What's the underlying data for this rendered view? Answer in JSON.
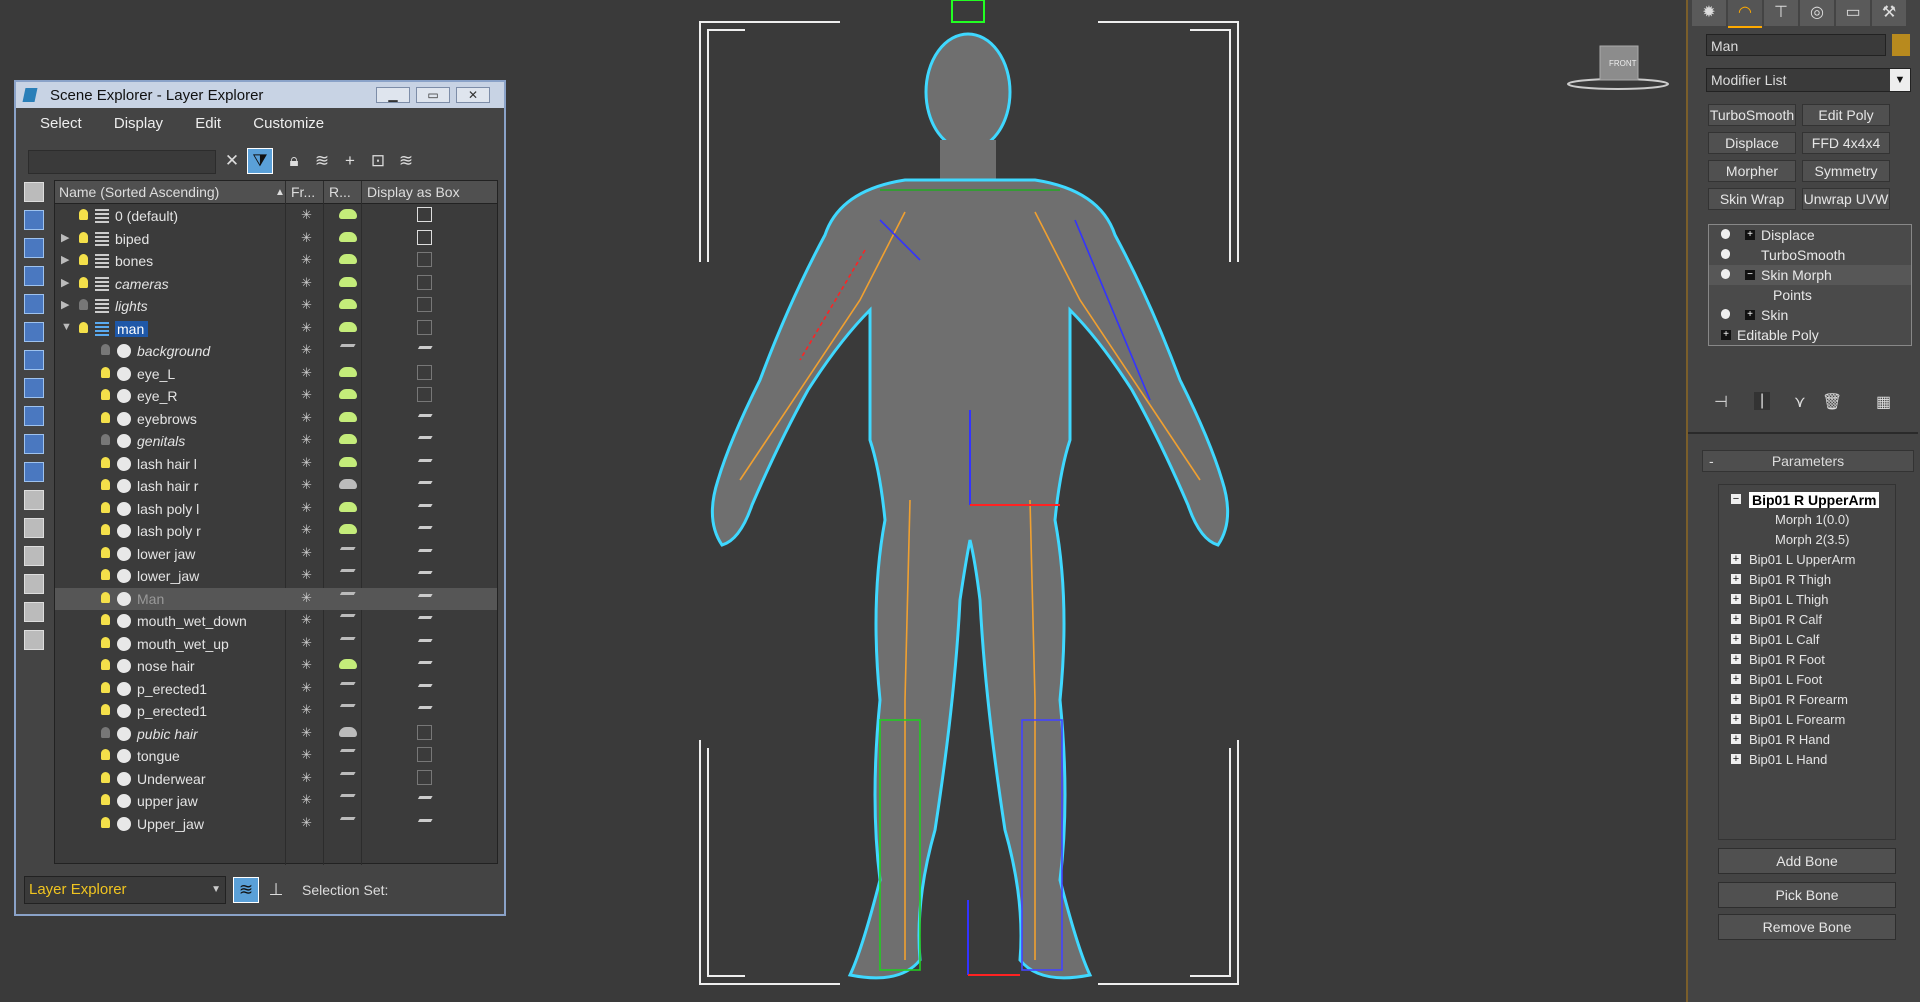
{
  "viewport": {
    "view_cube_label": "FRONT"
  },
  "scene_explorer": {
    "title": "Scene Explorer - Layer Explorer",
    "menu": [
      "Select",
      "Display",
      "Edit",
      "Customize"
    ],
    "columns": [
      "Name (Sorted Ascending)",
      "Fr...",
      "R...",
      "Display as Box"
    ],
    "rows": [
      {
        "name": "0 (default)",
        "level": 0,
        "exp": "",
        "italic": false,
        "bulb": true
      },
      {
        "name": "biped",
        "level": 0,
        "exp": "▶",
        "italic": false,
        "bulb": true
      },
      {
        "name": "bones",
        "level": 0,
        "exp": "▶",
        "italic": false,
        "bulb": true
      },
      {
        "name": "cameras",
        "level": 0,
        "exp": "▶",
        "italic": true,
        "bulb": true
      },
      {
        "name": "lights",
        "level": 0,
        "exp": "▶",
        "italic": true,
        "bulb": false
      },
      {
        "name": "man",
        "level": 0,
        "exp": "▼",
        "italic": false,
        "bulb": true,
        "highlight": true
      },
      {
        "name": "background",
        "level": 1,
        "italic": true,
        "bulb": false
      },
      {
        "name": "eye_L",
        "level": 1,
        "italic": false,
        "bulb": true
      },
      {
        "name": "eye_R",
        "level": 1,
        "italic": false,
        "bulb": true
      },
      {
        "name": "eyebrows",
        "level": 1,
        "italic": false,
        "bulb": true
      },
      {
        "name": "genitals",
        "level": 1,
        "italic": true,
        "bulb": false
      },
      {
        "name": "lash hair l",
        "level": 1,
        "italic": false,
        "bulb": true
      },
      {
        "name": "lash hair r",
        "level": 1,
        "italic": false,
        "bulb": true
      },
      {
        "name": "lash poly l",
        "level": 1,
        "italic": false,
        "bulb": true
      },
      {
        "name": "lash poly r",
        "level": 1,
        "italic": false,
        "bulb": true
      },
      {
        "name": "lower jaw",
        "level": 1,
        "italic": false,
        "bulb": true
      },
      {
        "name": "lower_jaw",
        "level": 1,
        "italic": false,
        "bulb": true
      },
      {
        "name": "Man",
        "level": 1,
        "italic": false,
        "bulb": true,
        "selected": true
      },
      {
        "name": "mouth_wet_down",
        "level": 1,
        "italic": false,
        "bulb": true
      },
      {
        "name": "mouth_wet_up",
        "level": 1,
        "italic": false,
        "bulb": true
      },
      {
        "name": "nose hair",
        "level": 1,
        "italic": false,
        "bulb": true
      },
      {
        "name": "p_erected1",
        "level": 1,
        "italic": false,
        "bulb": true
      },
      {
        "name": "p_erected1",
        "level": 1,
        "italic": false,
        "bulb": true
      },
      {
        "name": "pubic hair",
        "level": 1,
        "italic": true,
        "bulb": false
      },
      {
        "name": "tongue",
        "level": 1,
        "italic": false,
        "bulb": true
      },
      {
        "name": "Underwear",
        "level": 1,
        "italic": false,
        "bulb": true
      },
      {
        "name": "upper jaw",
        "level": 1,
        "italic": false,
        "bulb": true
      },
      {
        "name": "Upper_jaw",
        "level": 1,
        "italic": false,
        "bulb": true
      }
    ],
    "footer_dropdown": "Layer Explorer",
    "selection_set_label": "Selection Set:"
  },
  "command_panel": {
    "object_name": "Man",
    "object_color": "#b88a1e",
    "modifier_list": "Modifier List",
    "modifier_buttons": [
      "TurboSmooth",
      "Edit Poly",
      "Displace",
      "FFD 4x4x4",
      "Morpher",
      "Symmetry",
      "Skin Wrap",
      "Unwrap UVW"
    ],
    "stack": [
      {
        "label": "Displace",
        "bulb": true,
        "plus": true,
        "indent": 0,
        "highlight": false
      },
      {
        "label": "TurboSmooth",
        "bulb": true,
        "plus": false,
        "indent": 0,
        "highlight": false
      },
      {
        "label": "Skin Morph",
        "bulb": true,
        "plus": true,
        "minus": true,
        "indent": 0,
        "highlight": true
      },
      {
        "label": "Points",
        "bulb": false,
        "plus": false,
        "indent": 1,
        "highlight": false
      },
      {
        "label": "Skin",
        "bulb": true,
        "plus": true,
        "indent": 0,
        "highlight": false
      },
      {
        "label": "Editable Poly",
        "bulb": false,
        "plus": true,
        "indent": 0,
        "highlight": false
      }
    ],
    "rollout_title": "Parameters",
    "bone_tree": [
      {
        "label": "Bip01 R UpperArm",
        "sign": "−",
        "bold": true
      },
      {
        "label": "Morph 1(0.0)",
        "sub": true
      },
      {
        "label": "Morph 2(3.5)",
        "sub": true
      },
      {
        "label": "Bip01 L UpperArm",
        "sign": "+"
      },
      {
        "label": "Bip01 R Thigh",
        "sign": "+"
      },
      {
        "label": "Bip01 L Thigh",
        "sign": "+"
      },
      {
        "label": "Bip01 R Calf",
        "sign": "+"
      },
      {
        "label": "Bip01 L Calf",
        "sign": "+"
      },
      {
        "label": "Bip01 R Foot",
        "sign": "+"
      },
      {
        "label": "Bip01 L Foot",
        "sign": "+"
      },
      {
        "label": "Bip01 R Forearm",
        "sign": "+"
      },
      {
        "label": "Bip01 L Forearm",
        "sign": "+"
      },
      {
        "label": "Bip01 R Hand",
        "sign": "+"
      },
      {
        "label": "Bip01 L Hand",
        "sign": "+"
      }
    ],
    "buttons": {
      "add_bone": "Add Bone",
      "pick_bone": "Pick Bone",
      "remove_bone": "Remove Bone"
    }
  }
}
